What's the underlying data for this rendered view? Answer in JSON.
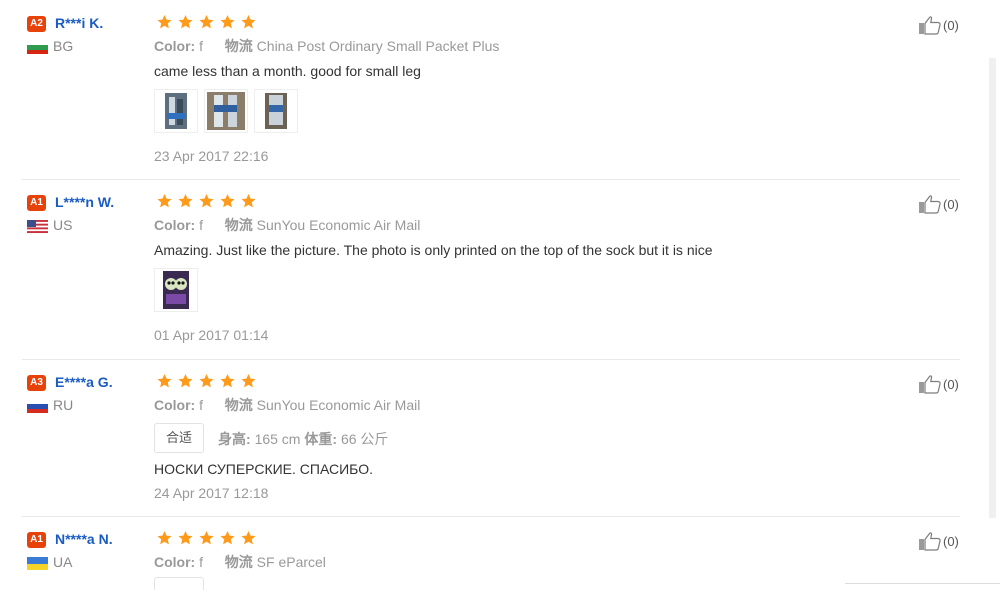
{
  "colors": {
    "level_badge": "#e8420b",
    "user_name": "#1a5bc4",
    "star": "#ff9a1a",
    "muted_text": "#999999",
    "divider": "#e8e8e8"
  },
  "reviews": [
    {
      "level": "A2",
      "user": "R***i K.",
      "flag_icon": "bulgaria-flag-icon",
      "country": "BG",
      "rating": 5,
      "color_label": "Color:",
      "color_value": "f",
      "shipping_label": "物流",
      "shipping_value": "China Post Ordinary Small Packet Plus",
      "text": "came less than a month. good for small leg",
      "photo_count": 3,
      "date": "23 Apr 2017 22:16",
      "likes": "(0)"
    },
    {
      "level": "A1",
      "user": "L****n W.",
      "flag_icon": "usa-flag-icon",
      "country": "US",
      "rating": 5,
      "color_label": "Color:",
      "color_value": "f",
      "shipping_label": "物流",
      "shipping_value": "SunYou Economic Air Mail",
      "text": "Amazing. Just like the picture. The photo is only printed on the top of the sock but it is nice",
      "photo_count": 1,
      "date": "01 Apr 2017 01:14",
      "likes": "(0)"
    },
    {
      "level": "A3",
      "user": "E****a G.",
      "flag_icon": "russia-flag-icon",
      "country": "RU",
      "rating": 5,
      "color_label": "Color:",
      "color_value": "f",
      "shipping_label": "物流",
      "shipping_value": "SunYou Economic Air Mail",
      "fit": "合适",
      "height_label": "身高:",
      "height_value": "165 cm",
      "weight_label": "体重:",
      "weight_value": "66 公斤",
      "text": "НОСКИ СУПЕРСКИЕ. СПАСИБО.",
      "date": "24 Apr 2017 12:18",
      "likes": "(0)"
    },
    {
      "level": "A1",
      "user": "N****a N.",
      "flag_icon": "ukraine-flag-icon",
      "country": "UA",
      "rating": 5,
      "color_label": "Color:",
      "color_value": "f",
      "shipping_label": "物流",
      "shipping_value": "SF eParcel",
      "likes": "(0)"
    }
  ]
}
